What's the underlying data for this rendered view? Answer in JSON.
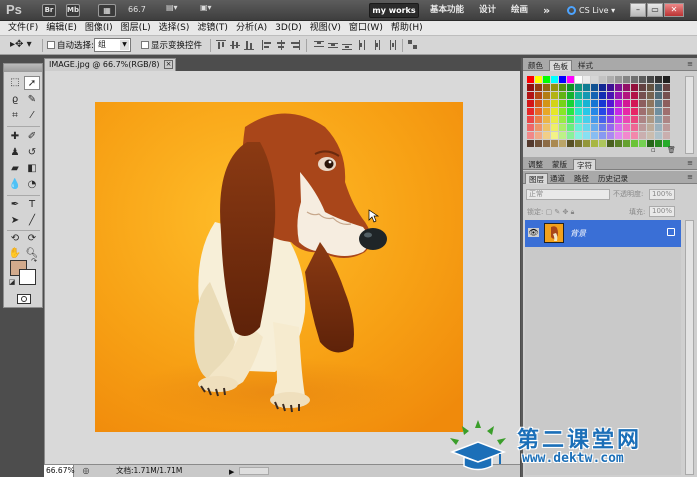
{
  "appbar": {
    "logo": "Ps",
    "icon_br": "Br",
    "icon_mb": "Mb",
    "zoom": "66.7",
    "workspaces": {
      "active": "my works",
      "basic": "基本功能",
      "design": "设计",
      "paint": "绘画",
      "more": "»"
    },
    "cslive": "CS Live"
  },
  "menu": [
    "文件(F)",
    "编辑(E)",
    "图像(I)",
    "图层(L)",
    "选择(S)",
    "滤镜(T)",
    "分析(A)",
    "3D(D)",
    "视图(V)",
    "窗口(W)",
    "帮助(H)"
  ],
  "options": {
    "auto_select_label": "自动选择:",
    "auto_select_value": "组",
    "show_transform_label": "显示变换控件"
  },
  "document": {
    "tab_title": "IMAGE.jpg @ 66.7%(RGB/8)",
    "close": "×",
    "canvas_color": "#f5a415"
  },
  "status": {
    "zoom": "66.67%",
    "info": "文档:1.71M/1.71M",
    "arrow": "▶"
  },
  "swatches_panel": {
    "tabs": [
      "颜色",
      "色板",
      "样式"
    ],
    "active_tab": 1
  },
  "adjust_panel": {
    "tabs": [
      "调整",
      "蒙版",
      "字符"
    ],
    "active_tab": 2
  },
  "layers_panel": {
    "tabs": [
      "图层",
      "通道",
      "路径",
      "历史记录"
    ],
    "active_tab": 0,
    "blend_mode": "正常",
    "opacity_label": "不透明度:",
    "opacity_value": "100%",
    "lock_label": "锁定:",
    "fill_label": "填充:",
    "fill_value": "100%",
    "layers": [
      {
        "name": "背景",
        "visible": true,
        "locked": true
      }
    ]
  },
  "watermark": {
    "title": "第二课堂网",
    "url": "www.dektw.com"
  },
  "colors": {
    "foreground": "#d2aa8c",
    "background": "#ffffff",
    "accent": "#3a6fd6"
  }
}
